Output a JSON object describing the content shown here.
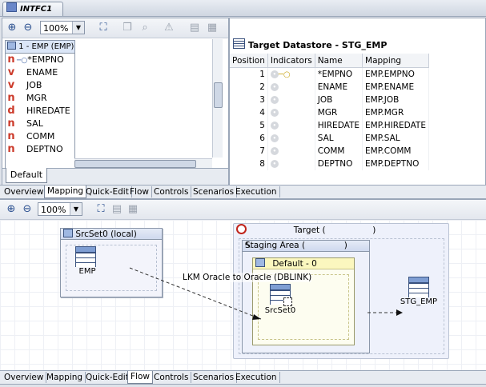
{
  "document_tab": {
    "label": "INTFC1"
  },
  "upper_toolbar": {
    "zoom": "100%"
  },
  "source_tree": {
    "title": "1 - EMP (EMP)",
    "items": [
      {
        "indicator": "n",
        "key": true,
        "name": "*EMPNO"
      },
      {
        "indicator": "v",
        "key": false,
        "name": "ENAME"
      },
      {
        "indicator": "v",
        "key": false,
        "name": "JOB"
      },
      {
        "indicator": "n",
        "key": false,
        "name": "MGR"
      },
      {
        "indicator": "d",
        "key": false,
        "name": "HIREDATE"
      },
      {
        "indicator": "n",
        "key": false,
        "name": "SAL"
      },
      {
        "indicator": "n",
        "key": false,
        "name": "COMM"
      },
      {
        "indicator": "n",
        "key": false,
        "name": "DEPTNO"
      }
    ],
    "bottom_tab": "Default"
  },
  "target_datastore": {
    "title": "Target Datastore - STG_EMP",
    "columns": [
      "Position",
      "Indicators",
      "Name",
      "Mapping"
    ],
    "rows": [
      {
        "position": "1",
        "name": "*EMPNO",
        "mapping": "EMP.EMPNO"
      },
      {
        "position": "2",
        "name": "ENAME",
        "mapping": "EMP.ENAME"
      },
      {
        "position": "3",
        "name": "JOB",
        "mapping": "EMP.JOB"
      },
      {
        "position": "4",
        "name": "MGR",
        "mapping": "EMP.MGR"
      },
      {
        "position": "5",
        "name": "HIREDATE",
        "mapping": "EMP.HIREDATE"
      },
      {
        "position": "6",
        "name": "SAL",
        "mapping": "EMP.SAL"
      },
      {
        "position": "7",
        "name": "COMM",
        "mapping": "EMP.COMM"
      },
      {
        "position": "8",
        "name": "DEPTNO",
        "mapping": "EMP.DEPTNO"
      }
    ]
  },
  "editor_tabs": [
    "Overview",
    "Mapping",
    "Quick-Edit",
    "Flow",
    "Controls",
    "Scenarios",
    "Execution"
  ],
  "upper_active_tab": "Mapping",
  "lower_active_tab": "Flow",
  "lower_toolbar": {
    "zoom": "100%"
  },
  "flow": {
    "srcset_title": "SrcSet0 (local)",
    "emp_label": "EMP",
    "target_title": "Target (",
    "target_title_end": ")",
    "staging_title": "Staging Area (",
    "staging_title_end": ")",
    "default_title": "Default - 0",
    "srcset_node_label": "SrcSet0",
    "lkm_label": "LKM Oracle to Oracle (DBLINK)",
    "stg_label": "STG_EMP"
  },
  "colors": {
    "accent": "#3b5fa3",
    "tab_bg": "#e7ebf1",
    "staging_bg": "#eef1fb",
    "default_bg": "#fdfbd8"
  }
}
